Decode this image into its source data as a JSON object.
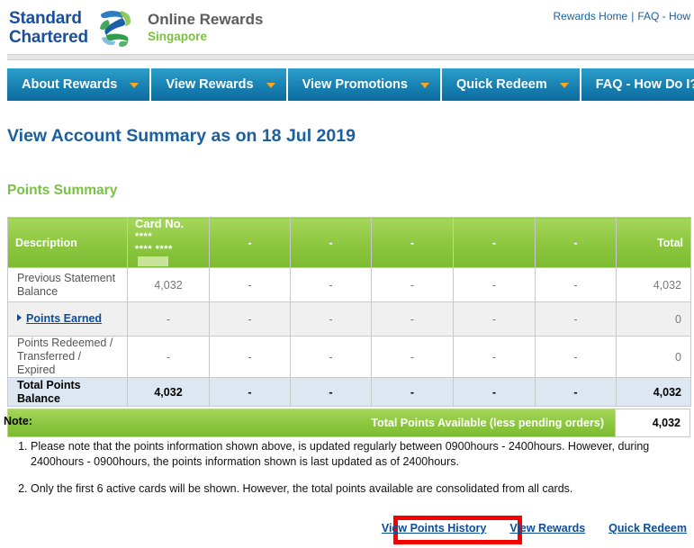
{
  "brand": {
    "wordmark_line1": "Standard",
    "wordmark_line2": "Chartered",
    "logo_icon": "standard-chartered-s-mark",
    "app_title": "Online Rewards",
    "country": "Singapore"
  },
  "toplinks": {
    "rewards_home": "Rewards Home",
    "separator": "|",
    "faq": "FAQ - How"
  },
  "nav": {
    "items": [
      {
        "label": "About Rewards",
        "caret": "chevron-down-icon"
      },
      {
        "label": "View Rewards",
        "caret": "chevron-down-icon"
      },
      {
        "label": "View Promotions",
        "caret": "chevron-down-icon"
      },
      {
        "label": "Quick Redeem",
        "caret": "chevron-down-icon"
      },
      {
        "label": "FAQ - How Do I?",
        "caret": "chevron-down-icon"
      }
    ]
  },
  "page": {
    "title": "View Account Summary as on 18 Jul 2019",
    "section_title": "Points Summary"
  },
  "table": {
    "headers": {
      "description": "Description",
      "card_no_label": "Card No.",
      "card_stars_top": "****",
      "card_stars_bottom": "**** ****",
      "card_redacted": "",
      "col3": "-",
      "col4": "-",
      "col5": "-",
      "col6": "-",
      "col7": "-",
      "total": "Total"
    },
    "rows": [
      {
        "description": "Previous Statement Balance",
        "cells": [
          "4,032",
          "-",
          "-",
          "-",
          "-",
          "-"
        ],
        "total": "4,032"
      },
      {
        "description": "Points Earned",
        "is_link": true,
        "expand_icon": "triangle-right-icon",
        "cells": [
          "-",
          "-",
          "-",
          "-",
          "-",
          "-"
        ],
        "total": "0"
      },
      {
        "description": "Points Redeemed / Transferred / Expired",
        "cells": [
          "-",
          "-",
          "-",
          "-",
          "-",
          "-"
        ],
        "total": "0"
      }
    ],
    "total_row": {
      "description": "Total Points Balance",
      "cells": [
        "4,032",
        "-",
        "-",
        "-",
        "-",
        "-"
      ],
      "total": "4,032"
    },
    "available": {
      "label": "Total Points Available (less pending orders)",
      "value": "4,032"
    }
  },
  "notes": {
    "heading": "Note:",
    "items": [
      "Please note that the points information shown above, is updated regularly between 0900hours - 2400hours. However, during 2400hours - 0900hours, the points information shown is last updated as of 2400hours.",
      "Only the first 6 active cards will be shown. However, the total points available are consolidated from all cards."
    ]
  },
  "footer": {
    "view_points_history": "View Points History",
    "view_rewards": "View Rewards",
    "quick_redeem": "Quick Redeem",
    "highlight_color": "#f60000"
  },
  "colors": {
    "brand_blue": "#1a4f9c",
    "brand_green": "#7ac143",
    "nav_blue": "#1b86b6",
    "table_green": "#8cc63f",
    "link_blue": "#0a4e9b",
    "title_blue": "#1a5fa0"
  }
}
